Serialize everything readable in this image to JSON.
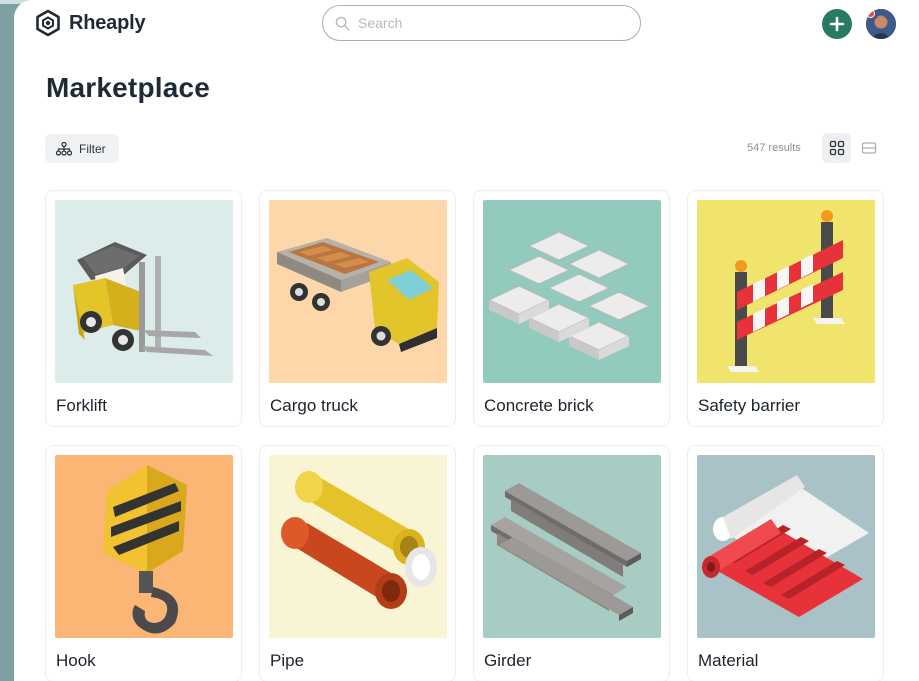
{
  "app": {
    "name": "Rheaply"
  },
  "search": {
    "placeholder": "Search"
  },
  "page": {
    "title": "Marketplace"
  },
  "toolbar": {
    "filter_label": "Filter",
    "results_text": "547 results",
    "view_modes": [
      "grid",
      "list"
    ],
    "active_view": "grid"
  },
  "colors": {
    "brand_text": "#1f2a37",
    "accent_green": "#2a7a63",
    "notification_dot": "#e24d3c"
  },
  "icons": {
    "logo": "hexagon-logo-icon",
    "search": "search-icon",
    "add": "plus-icon",
    "filter": "filter-hierarchy-icon",
    "grid_view": "grid-view-icon",
    "list_view": "list-view-icon"
  },
  "products": [
    {
      "title": "Forklift",
      "bg": "#dcecea",
      "image": "forklift-image"
    },
    {
      "title": "Cargo truck",
      "bg": "#fdd7aa",
      "image": "cargo-truck-image"
    },
    {
      "title": "Concrete brick",
      "bg": "#92cbbe",
      "image": "concrete-brick-image"
    },
    {
      "title": "Safety barrier",
      "bg": "#f1e46d",
      "image": "safety-barrier-image"
    },
    {
      "title": "Hook",
      "bg": "#fbb574",
      "image": "crane-hook-image"
    },
    {
      "title": "Pipe",
      "bg": "#f9f4d4",
      "image": "pipe-image"
    },
    {
      "title": "Girder",
      "bg": "#a7ccc4",
      "image": "girder-image"
    },
    {
      "title": "Material",
      "bg": "#a8c2c8",
      "image": "material-roll-image"
    }
  ]
}
